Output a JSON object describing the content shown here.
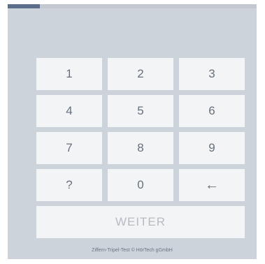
{
  "progress": {
    "fraction": 0.13
  },
  "keypad": {
    "keys": [
      {
        "label": "1",
        "name": "key-1",
        "icon": ""
      },
      {
        "label": "2",
        "name": "key-2",
        "icon": ""
      },
      {
        "label": "3",
        "name": "key-3",
        "icon": ""
      },
      {
        "label": "4",
        "name": "key-4",
        "icon": ""
      },
      {
        "label": "5",
        "name": "key-5",
        "icon": ""
      },
      {
        "label": "6",
        "name": "key-6",
        "icon": ""
      },
      {
        "label": "7",
        "name": "key-7",
        "icon": ""
      },
      {
        "label": "8",
        "name": "key-8",
        "icon": ""
      },
      {
        "label": "9",
        "name": "key-9",
        "icon": ""
      },
      {
        "label": "?",
        "name": "key-unknown",
        "icon": ""
      },
      {
        "label": "0",
        "name": "key-0",
        "icon": ""
      },
      {
        "label": "←",
        "name": "key-backspace",
        "icon": "arrow-left-icon"
      }
    ]
  },
  "weiter": {
    "label": "WEITER"
  },
  "footer": {
    "text": "Ziffern-Tripel-Test © HörTech gGmbH"
  },
  "colors": {
    "background": "#cdd3da",
    "progress_fill": "#5b6d89",
    "key_background": "#f3f4f6",
    "key_text": "#66707c",
    "disabled_text": "#b7bcc2"
  }
}
